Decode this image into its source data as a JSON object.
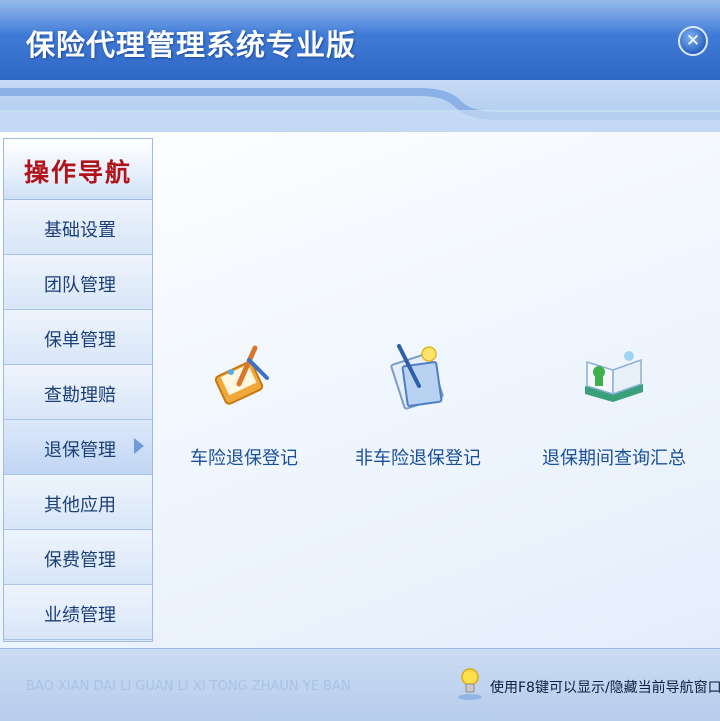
{
  "window": {
    "title": "保险代理管理系统专业版",
    "close_icon": "close-icon"
  },
  "nav": {
    "header": "操作导航",
    "items": [
      {
        "label": "基础设置",
        "active": false
      },
      {
        "label": "团队管理",
        "active": false
      },
      {
        "label": "保单管理",
        "active": false
      },
      {
        "label": "查勘理赔",
        "active": false
      },
      {
        "label": "退保管理",
        "active": true
      },
      {
        "label": "其他应用",
        "active": false
      },
      {
        "label": "保费管理",
        "active": false
      },
      {
        "label": "业绩管理",
        "active": false
      }
    ]
  },
  "features": [
    {
      "label": "车险退保登记",
      "icon": "pen-paper-icon"
    },
    {
      "label": "非车险退保登记",
      "icon": "document-lamp-icon"
    },
    {
      "label": "退保期间查询汇总",
      "icon": "open-book-icon"
    }
  ],
  "status": {
    "pinyin": "BAO XIAN DAI LI GUAN LI XI TONG ZHAUN YE BAN",
    "hint": "使用F8键可以显示/隐藏当前导航窗口",
    "hint_icon": "lightbulb-icon"
  },
  "colors": {
    "title_bar": "#3f7bd6",
    "nav_header_text": "#b0131a",
    "nav_text": "#1c3f78",
    "feature_text": "#1a4f9c"
  }
}
